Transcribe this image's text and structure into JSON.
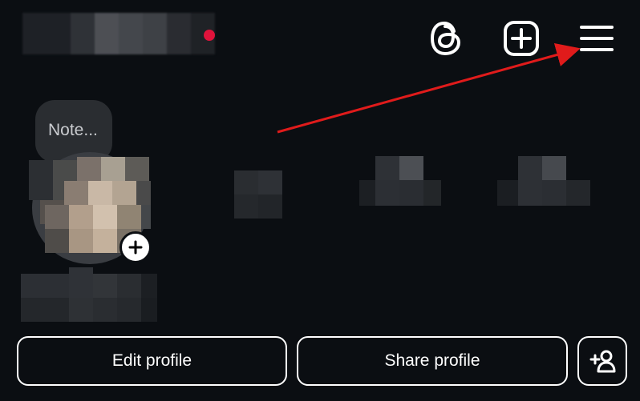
{
  "header": {
    "threads_icon": "threads-icon",
    "create_icon": "plus-square-icon",
    "menu_icon": "hamburger-menu-icon"
  },
  "note": {
    "placeholder": "Note..."
  },
  "avatar": {
    "add_story_icon": "plus-icon"
  },
  "actions": {
    "edit_profile": "Edit profile",
    "share_profile": "Share profile",
    "discover_people_icon": "add-person-icon"
  },
  "colors": {
    "background": "#0b0e12",
    "text": "#ffffff",
    "note_bg": "#2a2d31",
    "annotation_arrow": "#e01b1b",
    "unread_dot": "#e0133b"
  }
}
